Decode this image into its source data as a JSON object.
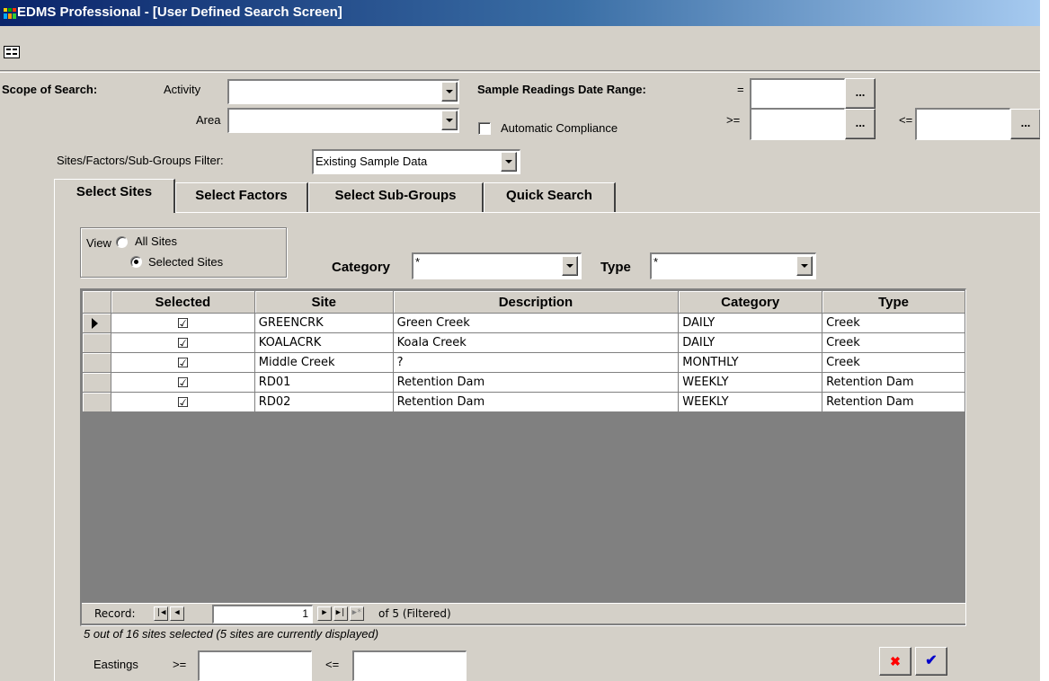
{
  "window": {
    "title": "EDMS Professional - [User Defined Search Screen]",
    "icon": "app-icon"
  },
  "toolbar": {
    "icon": "form-view-icon"
  },
  "scope": {
    "label": "Scope of Search:",
    "activity_label": "Activity",
    "activity_value": "",
    "area_label": "Area",
    "area_value": "",
    "auto_compliance_label": "Automatic Compliance",
    "auto_compliance_checked": false
  },
  "date_range": {
    "label": "Sample Readings Date Range:",
    "eq_label": "=",
    "ge_label": ">=",
    "le_label": "<=",
    "eq_value": "",
    "ge_value": "",
    "le_value": "",
    "button_label": "..."
  },
  "filter": {
    "label": "Sites/Factors/Sub-Groups Filter:",
    "value": "Existing Sample Data"
  },
  "tabs": [
    {
      "label": "Select Sites",
      "active": true
    },
    {
      "label": "Select Factors",
      "active": false
    },
    {
      "label": "Select Sub-Groups",
      "active": false
    },
    {
      "label": "Quick Search",
      "active": false
    }
  ],
  "view": {
    "label": "View",
    "options": [
      "All Sites",
      "Selected Sites"
    ],
    "selected": "Selected Sites"
  },
  "category": {
    "label": "Category",
    "value": "*"
  },
  "type": {
    "label": "Type",
    "value": "*"
  },
  "grid": {
    "columns": [
      "Selected",
      "Site",
      "Description",
      "Category",
      "Type"
    ],
    "rows": [
      {
        "selected": true,
        "site": "GREENCRK",
        "description": "Green Creek",
        "category": "DAILY",
        "type": "Creek",
        "current": true
      },
      {
        "selected": true,
        "site": "KOALACRK",
        "description": "Koala Creek",
        "category": "DAILY",
        "type": "Creek",
        "current": false
      },
      {
        "selected": true,
        "site": "Middle Creek",
        "description": "?",
        "category": "MONTHLY",
        "type": "Creek",
        "current": false
      },
      {
        "selected": true,
        "site": "RD01",
        "description": "Retention Dam",
        "category": "WEEKLY",
        "type": "Retention Dam",
        "current": false
      },
      {
        "selected": true,
        "site": "RD02",
        "description": "Retention Dam",
        "category": "WEEKLY",
        "type": "Retention Dam",
        "current": false
      }
    ]
  },
  "record_nav": {
    "label": "Record:",
    "current": "1",
    "total_text": "of 5 (Filtered)"
  },
  "status": "5 out of 16 sites selected (5 sites are currently displayed)",
  "eastings": {
    "label": "Eastings",
    "ge_label": ">=",
    "le_label": "<=",
    "ge_value": "",
    "le_value": ""
  },
  "buttons": {
    "cancel_icon": "cross-icon",
    "ok_icon": "checkmark-icon"
  },
  "colors": {
    "face": "#d4d0c8",
    "title_start": "#0a246a",
    "title_end": "#a6caf0",
    "cancel": "#ff0000",
    "ok": "#0000cc"
  }
}
